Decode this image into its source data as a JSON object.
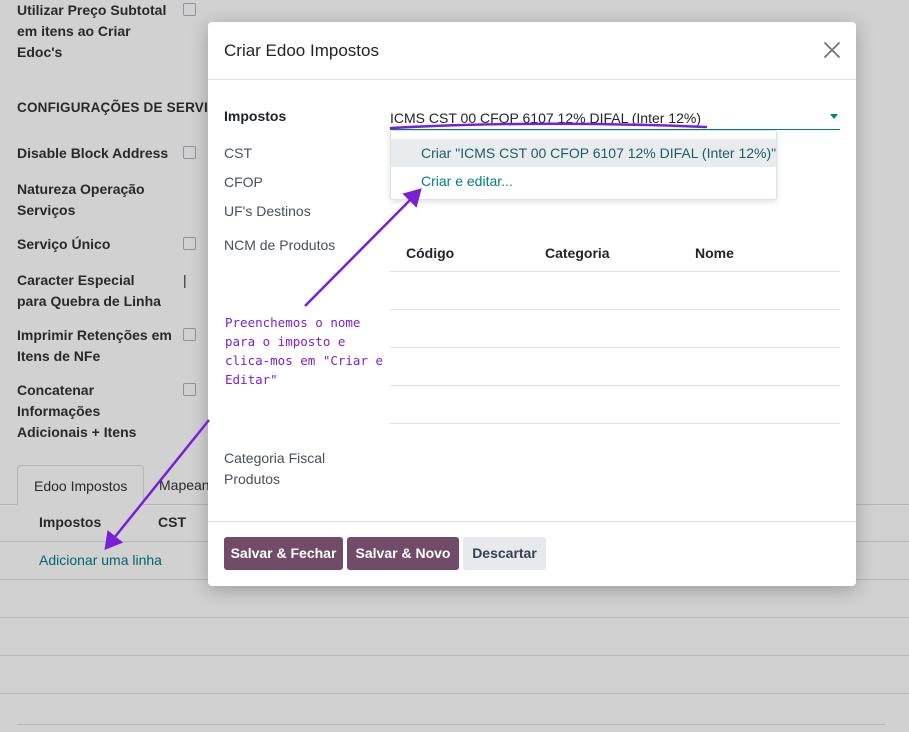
{
  "background": {
    "fields": [
      {
        "label": "Utilizar Preço Subtotal em itens ao Criar Edoc's"
      },
      {
        "label": "Disable Block Address"
      },
      {
        "label": "Natureza Operação Serviços"
      },
      {
        "label": "Serviço Único"
      },
      {
        "label": "Caracter Especial para Quebra de Linha",
        "value": "|"
      },
      {
        "label": "Imprimir Retenções em Itens de NFe"
      },
      {
        "label": "Concatenar Informações Adicionais + Itens"
      }
    ],
    "section_title": "CONFIGURAÇÕES DE SERVIÇOS",
    "tabs": [
      "Edoo Impostos",
      "Mapean"
    ],
    "table_headers": [
      "Impostos",
      "CST"
    ],
    "add_line": "Adicionar uma linha"
  },
  "modal": {
    "title": "Criar Edoo Impostos",
    "fields": {
      "impostos_label": "Impostos",
      "impostos_value": "ICMS CST 00 CFOP 6107 12% DIFAL (Inter 12%)",
      "cst_label": "CST",
      "cfop_label": "CFOP",
      "uf_label": "UF's Destinos",
      "ncm_label": "NCM de Produtos",
      "categoria_label": "Categoria Fiscal Produtos"
    },
    "dropdown": {
      "create_option": "Criar \"ICMS CST 00 CFOP 6107 12% DIFAL (Inter 12%)\"",
      "create_edit_option": "Criar e editar..."
    },
    "ncm_table": {
      "headers": [
        "Código",
        "Categoria",
        "Nome"
      ]
    },
    "buttons": {
      "save_close": "Salvar & Fechar",
      "save_new": "Salvar & Novo",
      "discard": "Descartar"
    }
  },
  "annotation": {
    "text": "Preenchemos o nome para o imposto e clica-mos em \"Criar e Editar\"",
    "color": "#7b1fd6"
  },
  "colors": {
    "primary": "#714b67",
    "link": "#017e84",
    "annotation": "#7b1fd6"
  }
}
